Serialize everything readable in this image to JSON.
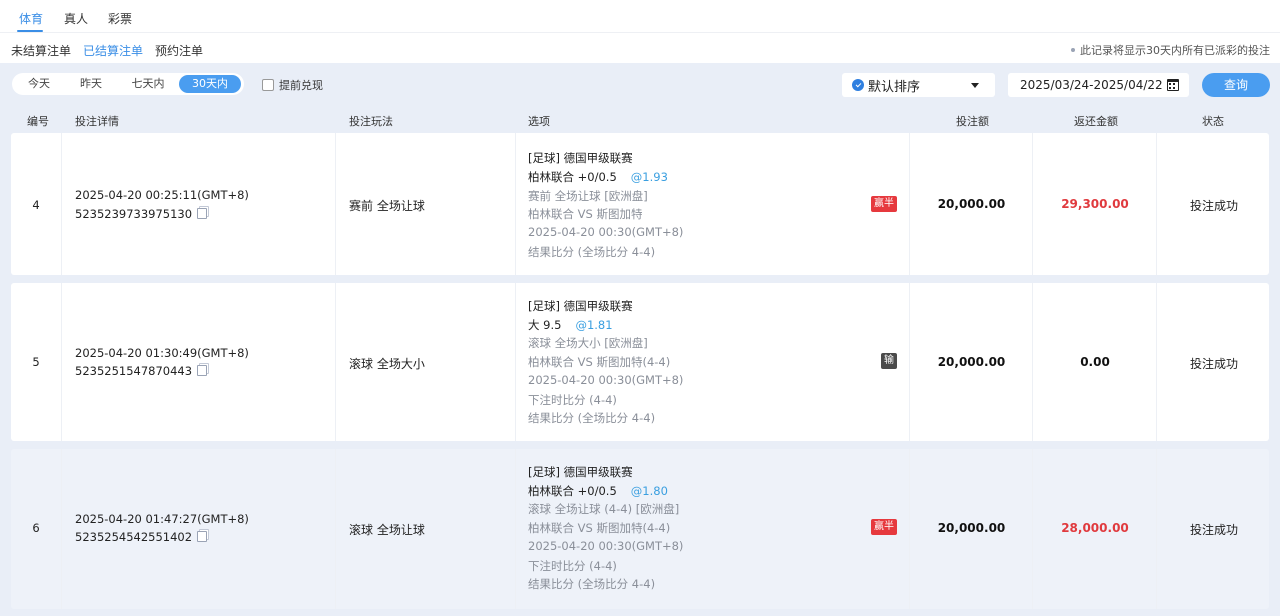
{
  "top_tabs": [
    {
      "label": "体育",
      "active": true
    },
    {
      "label": "真人",
      "active": false
    },
    {
      "label": "彩票",
      "active": false
    }
  ],
  "sub_tabs": [
    {
      "label": "未结算注单",
      "active": false
    },
    {
      "label": "已结算注单",
      "active": true
    },
    {
      "label": "预约注单",
      "active": false
    }
  ],
  "notice": "此记录将显示30天内所有已派彩的投注",
  "filters": {
    "ranges": [
      {
        "label": "今天",
        "active": false
      },
      {
        "label": "昨天",
        "active": false
      },
      {
        "label": "七天内",
        "active": false
      },
      {
        "label": "30天内",
        "active": true
      }
    ],
    "advance_label": "提前兑现",
    "advance_checked": false,
    "sort_label": "默认排序",
    "date_range": "2025/03/24-2025/04/22",
    "query_label": "查询"
  },
  "table": {
    "headers": [
      "编号",
      "投注详情",
      "投注玩法",
      "选项",
      "投注额",
      "返还金额",
      "状态"
    ],
    "rows": [
      {
        "id": "4",
        "time": "2025-04-20 00:25:11(GMT+8)",
        "order_no": "5235239733975130",
        "play": "赛前 全场让球",
        "league": "[足球] 德国甲级联赛",
        "pick": "柏林联合 +0/0.5",
        "odds": "@1.93",
        "details": [
          "赛前 全场让球 [欧洲盘]",
          "柏林联合 VS 斯图加特",
          "2025-04-20 00:30(GMT+8)",
          "结果比分 (全场比分 4-4)"
        ],
        "result_badge": "赢半",
        "result_color": "red",
        "stake": "20,000.00",
        "return": "29,300.00",
        "return_color": "red",
        "status": "投注成功"
      },
      {
        "id": "5",
        "time": "2025-04-20 01:30:49(GMT+8)",
        "order_no": "5235251547870443",
        "play": "滚球 全场大小",
        "league": "[足球] 德国甲级联赛",
        "pick": "大 9.5",
        "odds": "@1.81",
        "details": [
          "滚球 全场大小 [欧洲盘]",
          "柏林联合 VS 斯图加特(4-4)",
          "2025-04-20 00:30(GMT+8)",
          "下注时比分 (4-4)",
          "结果比分 (全场比分 4-4)"
        ],
        "result_badge": "输",
        "result_color": "dark",
        "stake": "20,000.00",
        "return": "0.00",
        "return_color": "black",
        "status": "投注成功"
      },
      {
        "id": "6",
        "time": "2025-04-20 01:47:27(GMT+8)",
        "order_no": "5235254542551402",
        "play": "滚球 全场让球",
        "league": "[足球] 德国甲级联赛",
        "pick": "柏林联合 +0/0.5",
        "odds": "@1.80",
        "details": [
          "滚球 全场让球 (4-4) [欧洲盘]",
          "柏林联合 VS 斯图加特(4-4)",
          "2025-04-20 00:30(GMT+8)",
          "下注时比分 (4-4)",
          "结果比分 (全场比分 4-4)"
        ],
        "result_badge": "赢半",
        "result_color": "red",
        "stake": "20,000.00",
        "return": "28,000.00",
        "return_color": "red",
        "status": "投注成功"
      }
    ]
  },
  "colors": {
    "accent": "#3a8ee6",
    "win": "#e03a3e",
    "lose_badge": "#4b4b4b",
    "odds": "#3a9fe0"
  },
  "icons": [
    "sort-check-icon",
    "dropdown-caret-icon",
    "calendar-icon",
    "copy-icon"
  ]
}
